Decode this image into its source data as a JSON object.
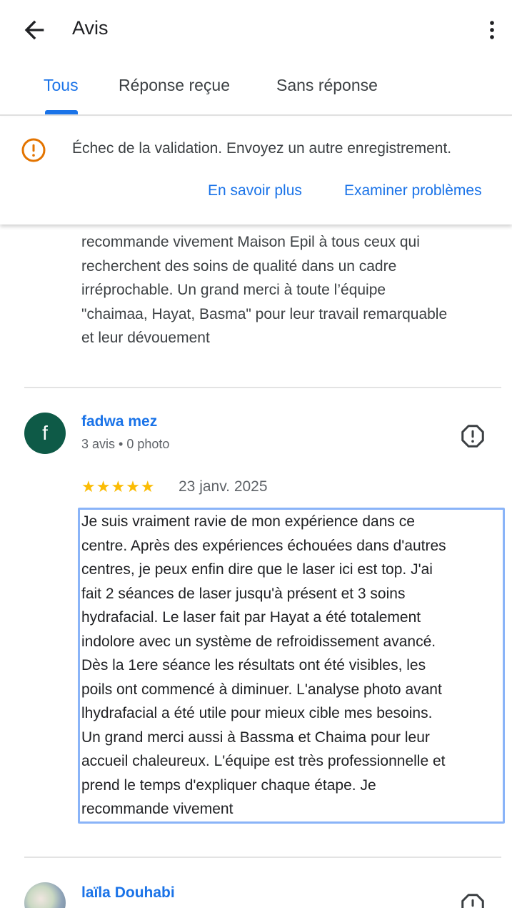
{
  "header": {
    "title": "Avis"
  },
  "tabs": [
    {
      "label": "Tous",
      "active": true
    },
    {
      "label": "Réponse reçue",
      "active": false
    },
    {
      "label": "Sans réponse",
      "active": false
    }
  ],
  "banner": {
    "message": "Échec de la validation. Envoyez un autre enregistrement.",
    "learn_more": "En savoir plus",
    "review_issues": "Examiner problèmes"
  },
  "previous_review": {
    "text_lines": [
      "recommande vivement Maison Epil à tous ceux qui",
      "recherchent des soins de qualité dans un cadre",
      "irréprochable. Un grand merci à toute l’équipe",
      "\"chaimaa, Hayat, Basma\" pour leur travail remarquable",
      "et leur dévouement"
    ]
  },
  "review": {
    "avatar_letter": "f",
    "name": "fadwa mez",
    "meta": "3 avis • 0 photo",
    "rating": 5,
    "stars": "★★★★★",
    "date": "23 janv. 2025",
    "text_lines": [
      "Je suis vraiment ravie de mon expérience dans ce",
      "centre. Après des expériences échouées dans d'autres",
      "centres, je peux enfin dire que le laser ici est top. J'ai",
      "fait 2 séances de laser jusqu'à présent et 3 soins",
      "hydrafacial. Le laser fait par Hayat a été totalement",
      "indolore avec un système de refroidissement avancé.",
      "Dès la 1ere séance les résultats ont été visibles, les",
      "poils ont commencé à diminuer. L'analyse photo avant",
      "lhydrafacial a été utile pour mieux cible mes besoins.",
      "Un grand merci aussi à Bassma et Chaima pour leur",
      "accueil chaleureux. L'équipe est très professionnelle et",
      "prend le temps d'expliquer chaque étape. Je",
      "recommande vivement"
    ]
  },
  "next_review": {
    "name": "laïla Douhabi"
  },
  "colors": {
    "accent": "#1a73e8",
    "warning": "#e37400",
    "avatar": "#0e5a47",
    "star": "#fbbc04"
  },
  "icons": {
    "back": "arrow-left-icon",
    "more": "more-vert-icon",
    "warning": "warning-circle-icon",
    "flag": "report-icon"
  }
}
